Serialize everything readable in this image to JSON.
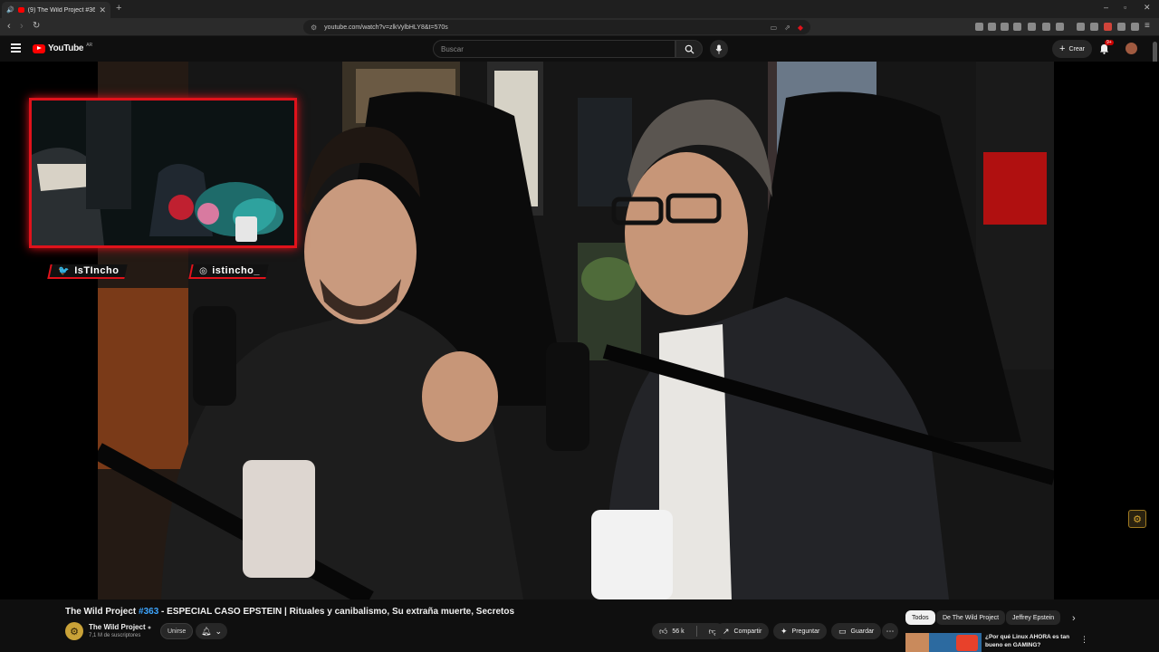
{
  "browser": {
    "tab_title": "(9) The Wild Project #363 - E",
    "tab_audio_icon": "speaker-icon",
    "new_tab": "+",
    "window_controls": [
      "–",
      "▫",
      "✕"
    ],
    "url": "youtube.com/watch?v=zlkVylbHLY8&t=570s"
  },
  "youtube": {
    "logo": "YouTube",
    "logo_region": "AR",
    "search_placeholder": "Buscar",
    "create_label": "Crear",
    "notifications_badge": "9+"
  },
  "overlay": {
    "twitter_handle": "IsTIncho",
    "instagram_handle": "istincho_"
  },
  "video": {
    "title_prefix": "The Wild Project ",
    "title_hash": "#363",
    "title_rest": " - ESPECIAL CASO EPSTEIN | Rituales y canibalismo, Su extraña muerte, Secretos"
  },
  "channel": {
    "name": "The Wild Project",
    "subscribers": "7,1 M de suscriptores",
    "join_label": "Unirse"
  },
  "actions": {
    "likes": "56 k",
    "share": "Compartir",
    "ask": "Preguntar",
    "save": "Guardar"
  },
  "chips": [
    "Todos",
    "De The Wild Project",
    "Jeffrey Epstein"
  ],
  "recommendation": {
    "title": "¿Por qué Linux AHORA es tan bueno en GAMING?"
  },
  "colors": {
    "accent_red": "#e0121b",
    "link_blue": "#3ea6ff",
    "background": "#0f0f0f"
  }
}
